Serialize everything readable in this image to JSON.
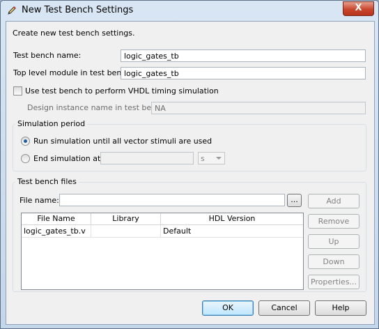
{
  "window": {
    "title": "New Test Bench Settings",
    "close_glyph": "X"
  },
  "intro": "Create new test bench settings.",
  "fields": {
    "tb_name_label": "Test bench name:",
    "tb_name_value": "logic_gates_tb",
    "top_module_label": "Top level module in test bench:",
    "top_module_value": "logic_gates_tb",
    "vhdl_timing_label": "Use test bench to perform VHDL timing simulation",
    "design_instance_label": "Design instance name in test bench:",
    "design_instance_value": "NA"
  },
  "simulation_period": {
    "title": "Simulation period",
    "run_all_label": "Run simulation until all vector stimuli are used",
    "end_at_label": "End simulation at:",
    "end_at_value": "",
    "unit_value": "s"
  },
  "files": {
    "title": "Test bench files",
    "file_name_label": "File name:",
    "file_name_value": "",
    "browse_label": "...",
    "columns": [
      "File Name",
      "Library",
      "HDL Version"
    ],
    "rows": [
      {
        "file": "logic_gates_tb.v",
        "library": "",
        "hdl": "Default"
      }
    ],
    "buttons": {
      "add": "Add",
      "remove": "Remove",
      "up": "Up",
      "down": "Down",
      "properties": "Properties..."
    }
  },
  "footer": {
    "ok": "OK",
    "cancel": "Cancel",
    "help": "Help"
  }
}
